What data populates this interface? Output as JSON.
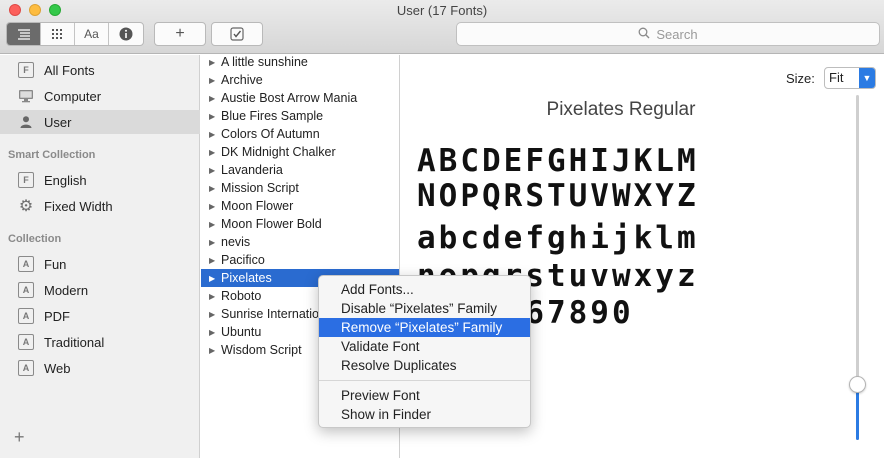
{
  "window": {
    "title": "User (17 Fonts)"
  },
  "toolbar": {
    "view_buttons": [
      "list-view",
      "grid-view",
      "sample-view",
      "info"
    ],
    "sample_label": "Aa",
    "add_label": "+",
    "search_placeholder": "Search"
  },
  "sidebar": {
    "library_items": [
      {
        "label": "All Fonts",
        "icon": "font-box-icon"
      },
      {
        "label": "Computer",
        "icon": "computer-icon"
      },
      {
        "label": "User",
        "icon": "user-icon",
        "selected": true
      }
    ],
    "smart_collection_header": "Smart Collection",
    "smart_items": [
      {
        "label": "English",
        "icon": "font-box-icon"
      },
      {
        "label": "Fixed Width",
        "icon": "gear-icon"
      }
    ],
    "collection_header": "Collection",
    "collection_items": [
      {
        "label": "Fun"
      },
      {
        "label": "Modern"
      },
      {
        "label": "PDF"
      },
      {
        "label": "Traditional"
      },
      {
        "label": "Web"
      }
    ],
    "add_button": "+"
  },
  "fonts": [
    "A little sunshine",
    "Archive",
    "Austie Bost Arrow Mania",
    "Blue Fires Sample",
    "Colors Of Autumn",
    "DK Midnight Chalker",
    "Lavanderia",
    "Mission Script",
    "Moon Flower",
    "Moon Flower Bold",
    "nevis",
    "Pacifico",
    "Pixelates",
    "Roboto",
    "Sunrise International",
    "Ubuntu",
    "Wisdom Script"
  ],
  "selected_font_index": 12,
  "preview": {
    "size_label": "Size:",
    "size_value": "Fit",
    "font_name": "Pixelates Regular",
    "sample_lines": [
      "ABCDEFGHIJKLM",
      "NOPQRSTUVWXYZ",
      "abcdefghijklm",
      "nopqrstuvwxyz",
      "1234567890"
    ]
  },
  "context_menu": {
    "group1": [
      "Add Fonts...",
      "Disable “Pixelates” Family",
      "Remove “Pixelates” Family",
      "Validate Font",
      "Resolve Duplicates"
    ],
    "group2": [
      "Preview Font",
      "Show in Finder"
    ],
    "highlighted": "Remove “Pixelates” Family"
  }
}
